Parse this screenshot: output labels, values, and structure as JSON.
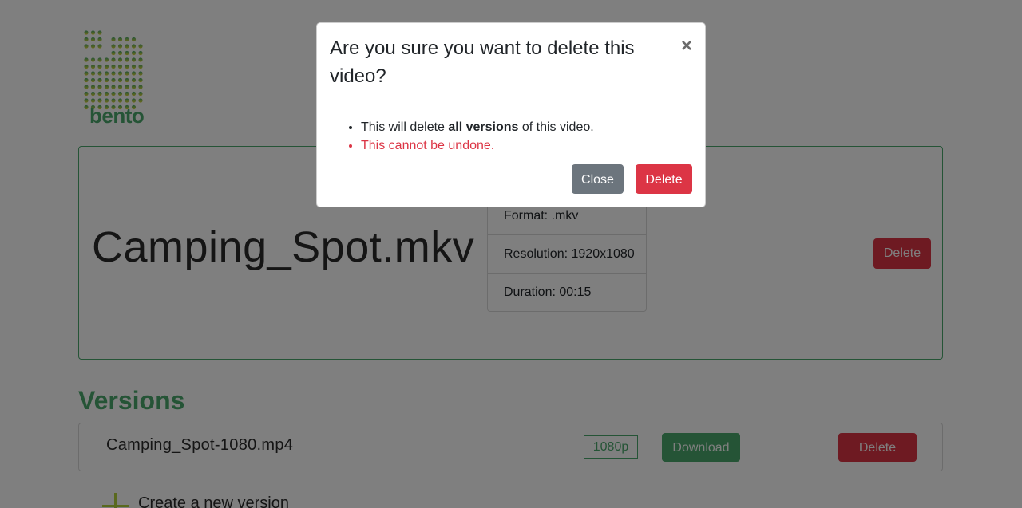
{
  "brand": {
    "name": "bento",
    "colors": {
      "primary": "#4aa96c",
      "accent": "#b5d33d",
      "danger": "#dc3545",
      "secondary": "#6c757d"
    }
  },
  "video": {
    "title": "Camping_Spot.mkv",
    "details": [
      "Format: .mkv",
      "Resolution: 1920x1080",
      "Duration: 00:15"
    ],
    "delete_label": "Delete"
  },
  "versions": {
    "heading": "Versions",
    "items": [
      {
        "name": "Camping_Spot-1080.mp4",
        "badge": "1080p",
        "download_label": "Download",
        "delete_label": "Delete"
      }
    ],
    "create_label": "Create a new version",
    "create_icon": "plus-icon"
  },
  "modal": {
    "title": "Are you sure you want to delete this video?",
    "close_symbol": "×",
    "bullet1_prefix": "This will delete ",
    "bullet1_bold": "all versions",
    "bullet1_suffix": " of this video.",
    "bullet2": "This cannot be undone.",
    "close_label": "Close",
    "delete_label": "Delete"
  }
}
